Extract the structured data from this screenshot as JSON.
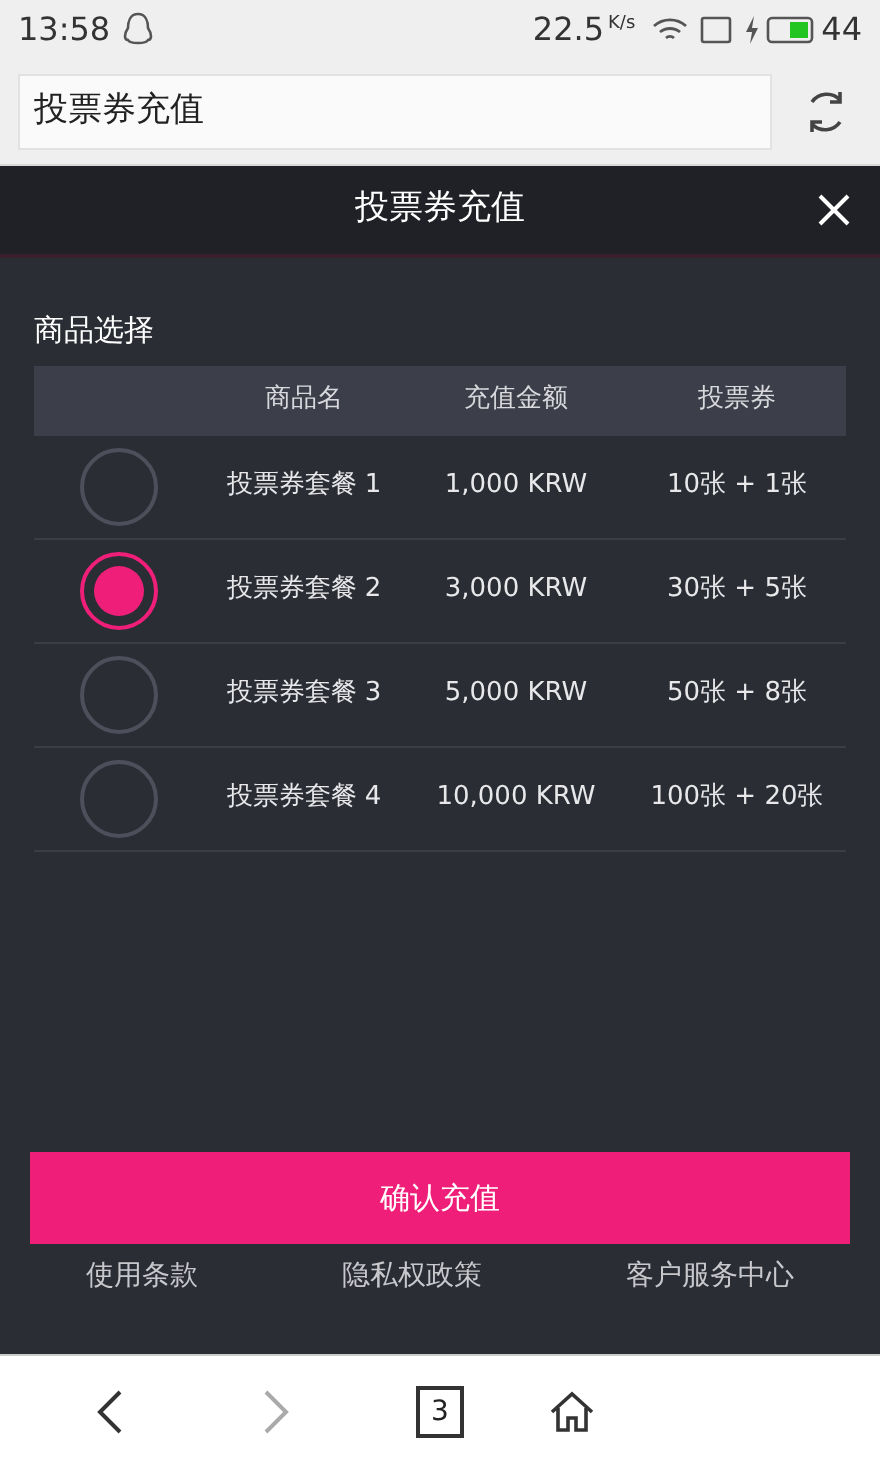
{
  "status_bar": {
    "time": "13:58",
    "speed": "22.5",
    "speed_unit": "K/s",
    "battery": "44"
  },
  "address_bar": {
    "value": "投票券充值"
  },
  "dialog": {
    "title": "投票券充值",
    "section_title": "商品选择",
    "table": {
      "columns": [
        "商品名",
        "充值金额",
        "投票券"
      ],
      "rows": [
        {
          "selected": false,
          "name": "投票券套餐 1",
          "amount": "1,000 KRW",
          "tickets": "10张 + 1张"
        },
        {
          "selected": true,
          "name": "投票券套餐 2",
          "amount": "3,000 KRW",
          "tickets": "30张 + 5张"
        },
        {
          "selected": false,
          "name": "投票券套餐 3",
          "amount": "5,000 KRW",
          "tickets": "50张 + 8张"
        },
        {
          "selected": false,
          "name": "投票券套餐 4",
          "amount": "10,000 KRW",
          "tickets": "100张 + 20张"
        }
      ]
    },
    "confirm_button": "确认充值",
    "footer_links": [
      "使用条款",
      "隐私权政策",
      "客户服务中心"
    ]
  },
  "browser_nav": {
    "forward_disabled": true,
    "tab_count": "3"
  }
}
